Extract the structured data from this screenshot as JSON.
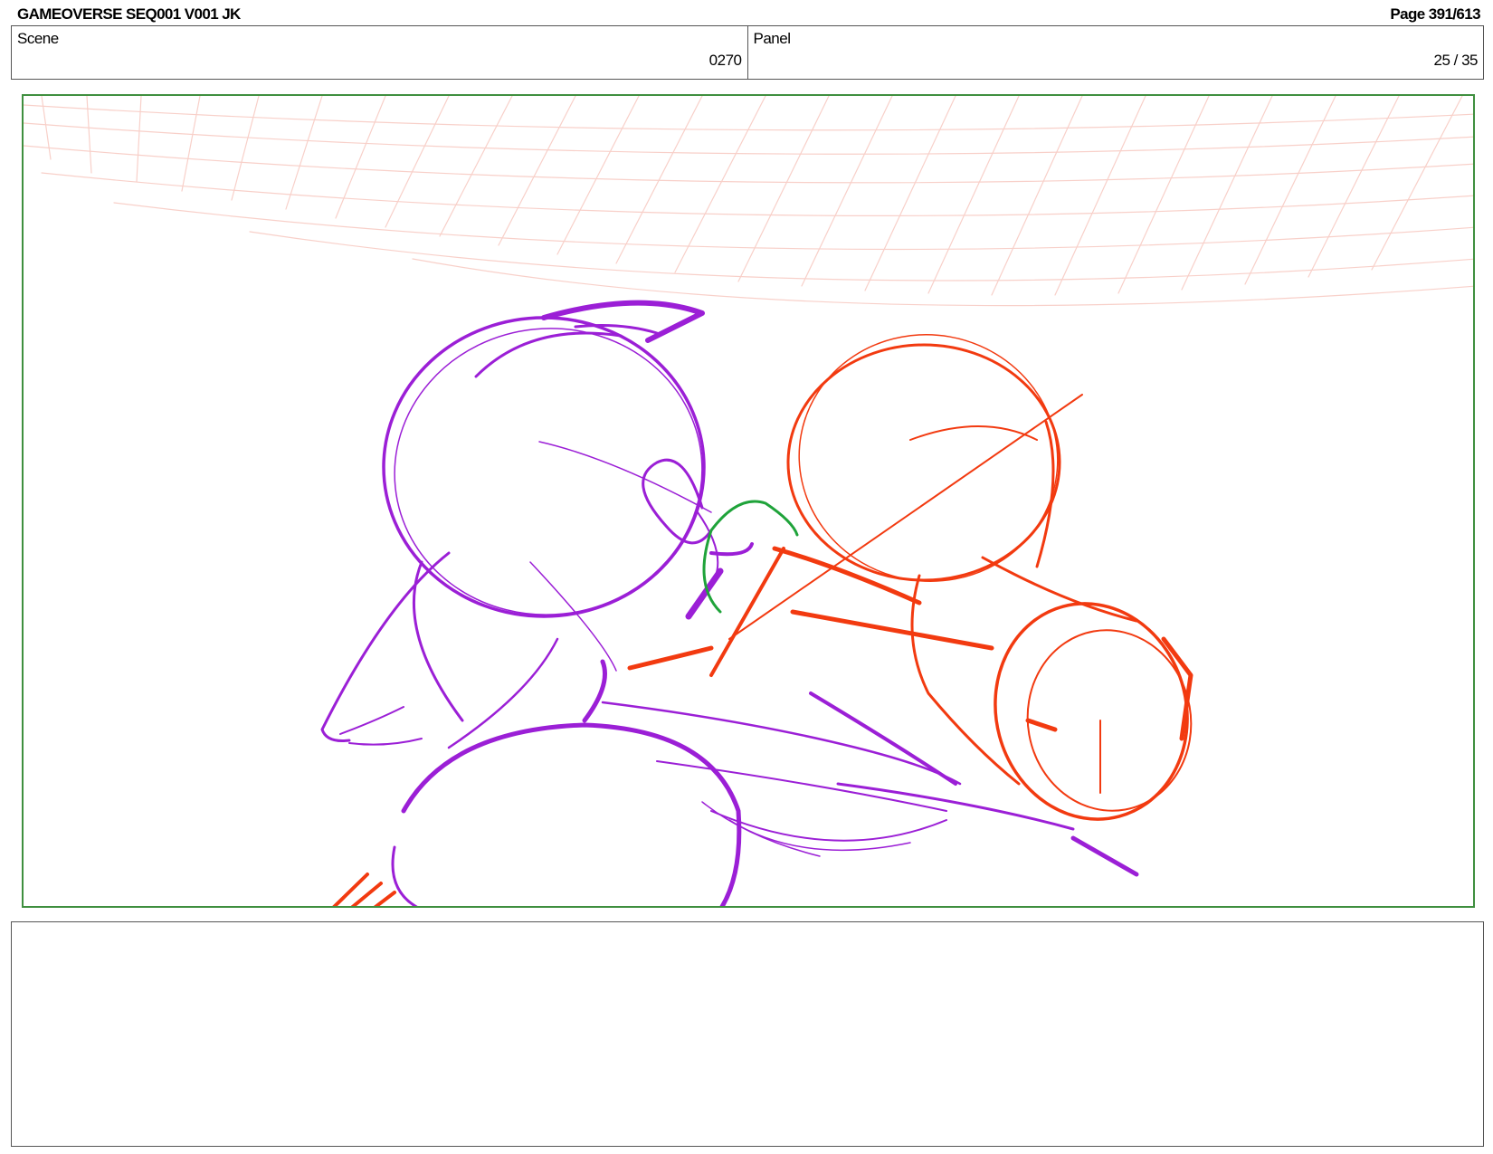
{
  "header": {
    "title": "GAMEOVERSE SEQ001 V001 JK",
    "page": "Page 391/613"
  },
  "info": {
    "scene_label": "Scene",
    "scene_value": "0270",
    "panel_label": "Panel",
    "panel_value": "25 / 35"
  },
  "colors": {
    "frame_border": "#3f8f3f",
    "perspective_grid": "#f7c8c0",
    "character_purple": "#9b1fd6",
    "character_red": "#f23a10",
    "accent_green": "#1fa33a"
  }
}
